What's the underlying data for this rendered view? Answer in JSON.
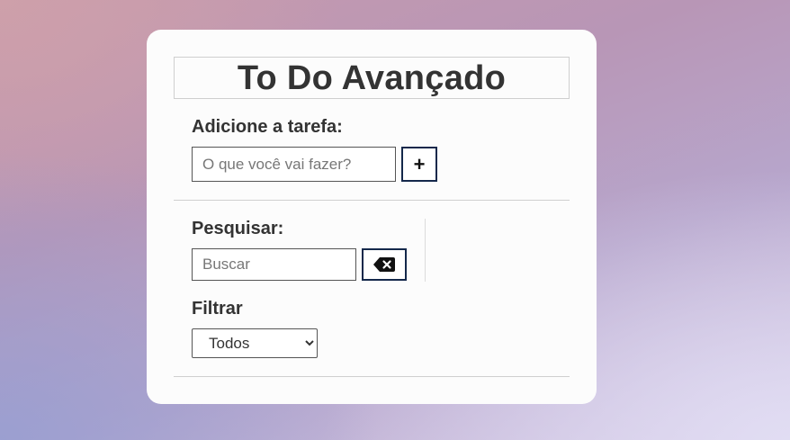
{
  "app": {
    "title": "To Do Avançado"
  },
  "add_section": {
    "label": "Adicione a tarefa:",
    "input_placeholder": "O que você vai fazer?",
    "input_value": "",
    "add_button_label": "+"
  },
  "search_section": {
    "label": "Pesquisar:",
    "input_placeholder": "Buscar",
    "input_value": "",
    "clear_icon": "backspace-icon"
  },
  "filter_section": {
    "label": "Filtrar",
    "selected": "Todos"
  },
  "colors": {
    "button_border": "#14284b",
    "text": "#333333",
    "card_bg": "#fcfcfc"
  }
}
